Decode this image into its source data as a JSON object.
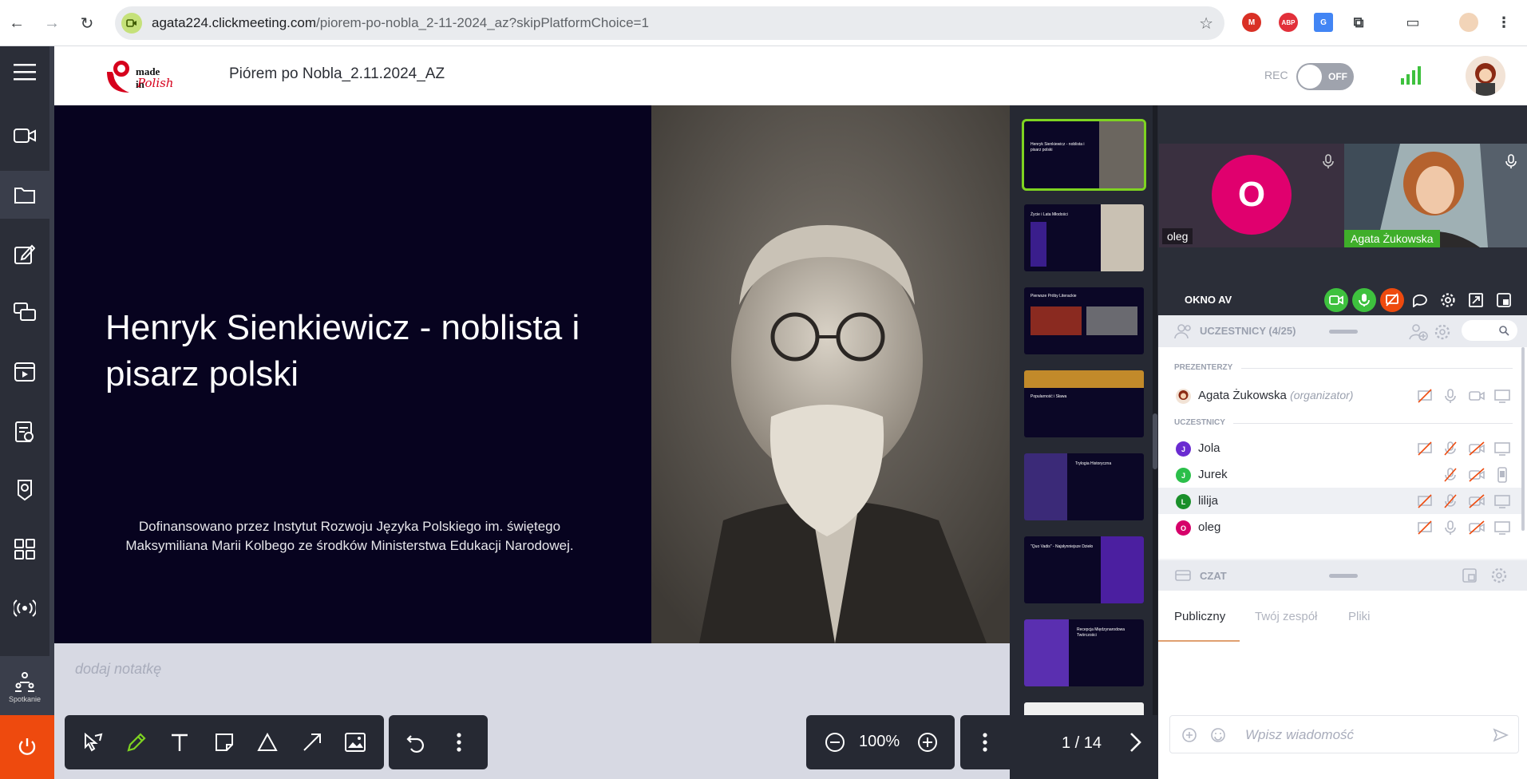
{
  "browser": {
    "url_host": "agata224.clickmeeting.com",
    "url_path": "/piorem-po-nobla_2-11-2024_az?skipPlatformChoice=1"
  },
  "header": {
    "logo_line1": "made in",
    "logo_line2": "Polish",
    "title": "Piórem po Nobla_2.11.2024_AZ",
    "rec_label": "REC",
    "rec_state": "OFF"
  },
  "sidebar": {
    "meeting_label": "Spotkanie"
  },
  "slide": {
    "title": "Henryk Sienkiewicz - noblista i pisarz polski",
    "credit": "Dofinansowano przez Instytut Rozwoju Języka Polskiego im. świętego Maksymiliana Marii Kolbego ze środków Ministerstwa Edukacji Narodowej."
  },
  "notes": {
    "placeholder": "dodaj notatkę"
  },
  "zoom": {
    "value": "100%"
  },
  "pagination": {
    "indicator": "1 / 14"
  },
  "thumbnails": [
    {
      "title": "Henryk Sienkiewicz - noblista i pisarz polski"
    },
    {
      "title": "Życie i Lata Młodości"
    },
    {
      "title": "Pierwsze Próby Literackie"
    },
    {
      "title": "Popularność i Sława"
    },
    {
      "title": "Trylogia Historyczna"
    },
    {
      "title": "\"Quo Vadis\" - Najsłynniejsze Dzieło"
    },
    {
      "title": "Recepcja Międzynarodowa Twórczości"
    }
  ],
  "videos": {
    "tile1_initial": "O",
    "tile1_name": "oleg",
    "tile2_name": "Agata Żukowska"
  },
  "av": {
    "title": "OKNO AV"
  },
  "participants": {
    "title": "UCZESTNICY (4/25)",
    "presenters_label": "PREZENTERZY",
    "attendees_label": "UCZESTNICY",
    "presenter": {
      "name": "Agata Żukowska",
      "role": "(organizator)"
    },
    "attendees": [
      {
        "initial": "J",
        "name": "Jola",
        "color": "#6a2bd1"
      },
      {
        "initial": "J",
        "name": "Jurek",
        "color": "#2bbf4a"
      },
      {
        "initial": "L",
        "name": "lilija",
        "color": "#1a8f2a"
      },
      {
        "initial": "O",
        "name": "oleg",
        "color": "#d6006a"
      }
    ]
  },
  "chat": {
    "title": "CZAT",
    "tabs": [
      "Publiczny",
      "Twój zespół",
      "Pliki"
    ],
    "placeholder": "Wpisz wiadomość"
  },
  "colors": {
    "accent_green": "#7ed321",
    "power_orange": "#ee4a0e",
    "sidebar_dark": "#2b2e38"
  }
}
